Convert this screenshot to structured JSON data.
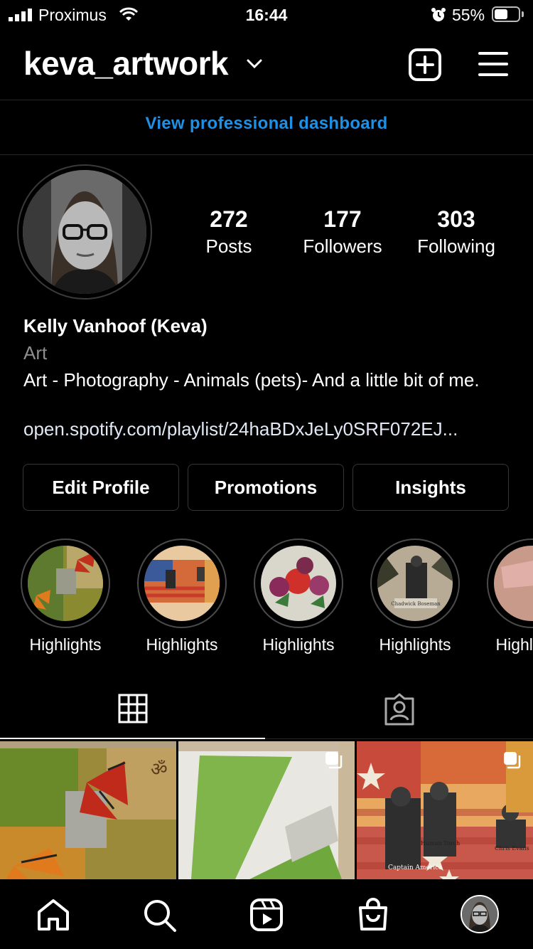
{
  "status_bar": {
    "carrier": "Proximus",
    "time": "16:44",
    "battery_percent": "55%",
    "battery_level": 0.55
  },
  "header": {
    "username": "keva_artwork",
    "dashboard_link": "View professional dashboard"
  },
  "stats": [
    {
      "value": "272",
      "label": "Posts"
    },
    {
      "value": "177",
      "label": "Followers"
    },
    {
      "value": "303",
      "label": "Following"
    }
  ],
  "bio": {
    "name": "Kelly Vanhoof (Keva)",
    "category": "Art",
    "text": "Art - Photography - Animals (pets)- And a little bit of me.",
    "link": "open.spotify.com/playlist/24haBDxJeLy0SRF072EJ..."
  },
  "buttons": {
    "edit_profile": "Edit Profile",
    "promotions": "Promotions",
    "insights": "Insights"
  },
  "highlights": [
    {
      "label": "Highlights"
    },
    {
      "label": "Highlights"
    },
    {
      "label": "Highlights"
    },
    {
      "label": "Highlights"
    },
    {
      "label": "Highlights"
    }
  ],
  "highlight_image_text": {
    "h4_caption": "Chadwick Boseman"
  },
  "grid_image_text": {
    "post3_captions": [
      "Captain America",
      "Human Torch",
      "Chris Evans"
    ]
  },
  "colors": {
    "background": "#000000",
    "link_blue": "#1e90e5",
    "muted_gray": "#8e8e8e",
    "border": "#363636"
  },
  "icons": {
    "tab_grid": "grid-icon",
    "tab_tagged": "tagged-person-icon",
    "nav": [
      "home-icon",
      "search-icon",
      "reels-icon",
      "shop-icon",
      "profile-avatar"
    ]
  }
}
